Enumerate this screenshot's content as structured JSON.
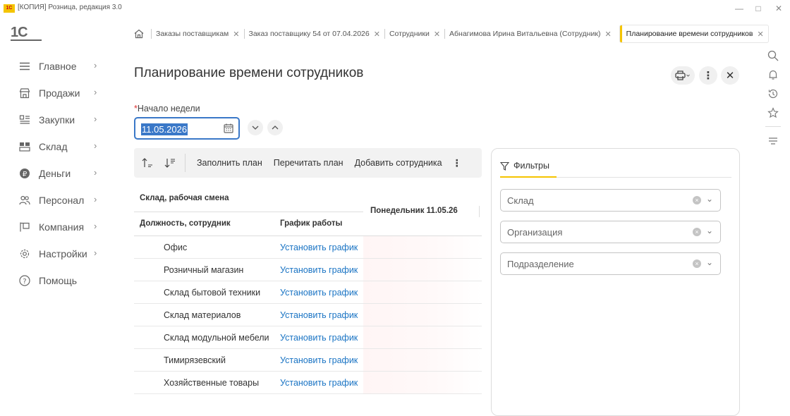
{
  "window": {
    "logo_text": "1С",
    "title": "[КОПИЯ] Розница, редакция 3.0",
    "controls": {
      "minimize": "—",
      "maximize": "□",
      "close": "✕"
    }
  },
  "brand": {
    "logo": "1С"
  },
  "tabs": [
    {
      "label": "Заказы поставщикам",
      "close": "✕"
    },
    {
      "label": "Заказ поставщику 54 от 07.04.2026",
      "close": "✕"
    },
    {
      "label": "Сотрудники",
      "close": "✕"
    },
    {
      "label": "Абнагимова Ирина Витальевна (Сотрудник)",
      "close": "✕"
    },
    {
      "label": "Планирование времени сотрудников",
      "close": "✕"
    }
  ],
  "sidebar": {
    "items": [
      {
        "label": "Главное",
        "icon": "menu-icon"
      },
      {
        "label": "Продажи",
        "icon": "shop-icon"
      },
      {
        "label": "Закупки",
        "icon": "purchases-icon"
      },
      {
        "label": "Склад",
        "icon": "warehouse-icon"
      },
      {
        "label": "Деньги",
        "icon": "money-icon"
      },
      {
        "label": "Персонал",
        "icon": "people-icon"
      },
      {
        "label": "Компания",
        "icon": "company-icon"
      },
      {
        "label": "Настройки",
        "icon": "settings-icon"
      },
      {
        "label": "Помощь",
        "icon": "help-icon"
      }
    ],
    "chevron": "›"
  },
  "page": {
    "title": "Планирование времени сотрудников",
    "more": "⋮",
    "close": "✕",
    "week_label_req": "*",
    "week_label": "Начало недели",
    "week_value": "11.05.2026"
  },
  "toolbar": {
    "fill_plan": "Заполнить план",
    "recalc_plan": "Перечитать план",
    "add_employee": "Добавить сотрудника",
    "more": "⋮"
  },
  "table": {
    "header_group": "Склад, рабочая смена",
    "header_position": "Должность, сотрудник",
    "header_schedule": "График работы",
    "header_day": "Понедельник  11.05.26",
    "rows": [
      {
        "name": "Офис",
        "schedule": "Установить график"
      },
      {
        "name": "Розничный магазин",
        "schedule": "Установить график"
      },
      {
        "name": "Склад бытовой техники",
        "schedule": "Установить график"
      },
      {
        "name": "Склад материалов",
        "schedule": "Установить график"
      },
      {
        "name": "Склад модульной мебели",
        "schedule": "Установить график"
      },
      {
        "name": "Тимирязевский",
        "schedule": "Установить график"
      },
      {
        "name": "Хозяйственные товары",
        "schedule": "Установить график"
      }
    ]
  },
  "filters": {
    "tab_label": "Фильтры",
    "fields": [
      {
        "placeholder": "Склад"
      },
      {
        "placeholder": "Организация"
      },
      {
        "placeholder": "Подразделение"
      }
    ]
  },
  "colors": {
    "accent": "#f5c400",
    "link": "#1a74c4",
    "focus": "#3a78c8"
  }
}
